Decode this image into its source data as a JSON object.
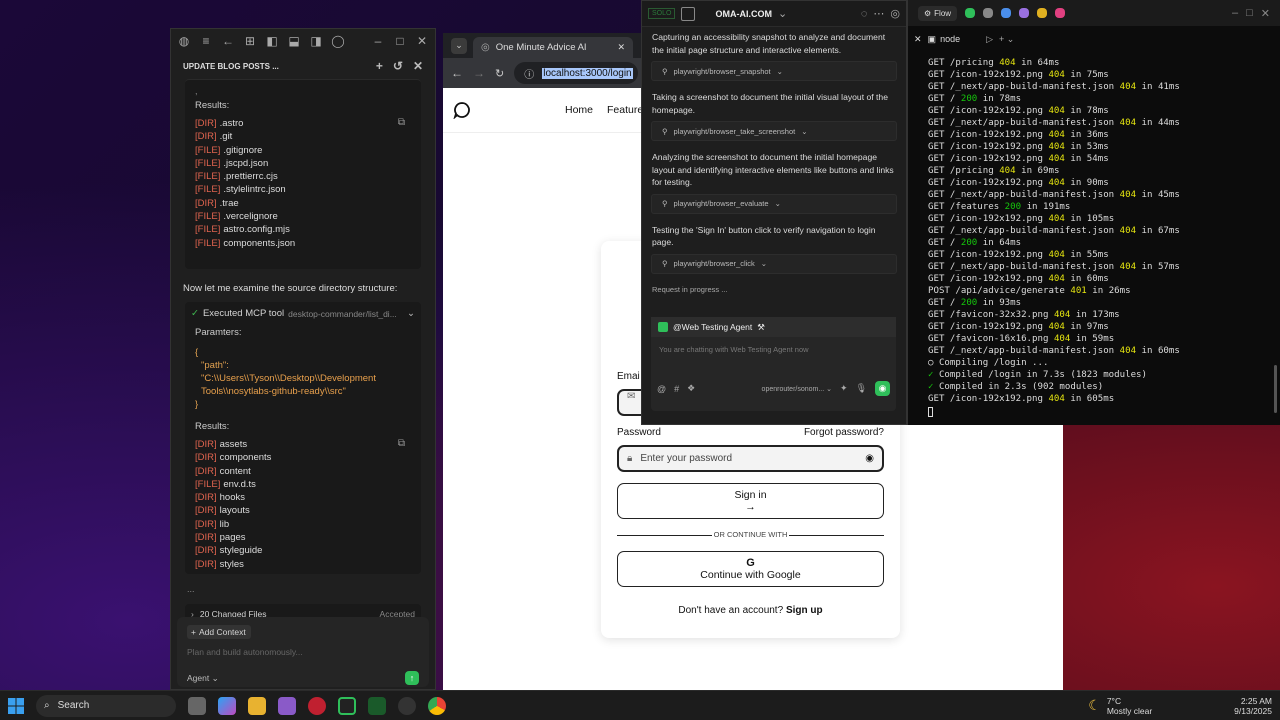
{
  "ide": {
    "header_title": "UPDATE BLOG POSTS ...",
    "results_label": "Results:",
    "results1": [
      {
        "tag": "[DIR]",
        "name": ".astro"
      },
      {
        "tag": "[DIR]",
        "name": ".git"
      },
      {
        "tag": "[FILE]",
        "name": ".gitignore"
      },
      {
        "tag": "[FILE]",
        "name": ".jscpd.json"
      },
      {
        "tag": "[FILE]",
        "name": ".prettierrc.cjs"
      },
      {
        "tag": "[FILE]",
        "name": ".stylelintrc.json"
      },
      {
        "tag": "[DIR]",
        "name": ".trae"
      },
      {
        "tag": "[FILE]",
        "name": ".vercelignore"
      },
      {
        "tag": "[FILE]",
        "name": "astro.config.mjs"
      },
      {
        "tag": "[FILE]",
        "name": "components.json"
      }
    ],
    "message": "Now let me examine the source directory structure:",
    "tool_label": "Executed MCP tool",
    "tool_name": "desktop-commander/list_di...",
    "params_label": "Paramters:",
    "code_open": "{",
    "code_key": "\"path\":",
    "code_val1": "\"C:\\\\Users\\\\Tyson\\\\Desktop\\\\Development",
    "code_val2": "Tools\\\\nosytlabs-github-ready\\\\src\"",
    "code_close": "}",
    "results2": [
      {
        "tag": "[DIR]",
        "name": "assets"
      },
      {
        "tag": "[DIR]",
        "name": "components"
      },
      {
        "tag": "[DIR]",
        "name": "content"
      },
      {
        "tag": "[FILE]",
        "name": "env.d.ts"
      },
      {
        "tag": "[DIR]",
        "name": "hooks"
      },
      {
        "tag": "[DIR]",
        "name": "layouts"
      },
      {
        "tag": "[DIR]",
        "name": "lib"
      },
      {
        "tag": "[DIR]",
        "name": "pages"
      },
      {
        "tag": "[DIR]",
        "name": "styleguide"
      },
      {
        "tag": "[DIR]",
        "name": "styles"
      }
    ],
    "dots": "...",
    "changed_files": "20 Changed Files",
    "accepted": "Accepted",
    "add_context": "Add Context",
    "input_placeholder": "Plan and build autonomously...",
    "mode": "Agent"
  },
  "browser": {
    "tab_title": "One Minute Advice AI",
    "url": "localhost:3000/login",
    "nav_home": "Home",
    "nav_features": "Features"
  },
  "login": {
    "email_label": "Emai",
    "password_label": "Password",
    "forgot": "Forgot password?",
    "password_placeholder": "Enter your password",
    "signin_label": "Sign in",
    "signin_arrow": "→",
    "divider": "OR CONTINUE WITH",
    "google_label": "Continue with Google",
    "no_account": "Don't have an account?",
    "signup": "Sign up"
  },
  "agent": {
    "badge": "SOLO",
    "title": "OMA-AI.COM",
    "flow": "Flow",
    "steps": [
      {
        "text": "Capturing an accessibility snapshot to analyze and document the initial page structure and interactive elements.",
        "tool": "playwright/browser_snapshot"
      },
      {
        "text": "Taking a screenshot to document the initial visual layout of the homepage.",
        "tool": "playwright/browser_take_screenshot"
      },
      {
        "text": "Analyzing the screenshot to document the initial homepage layout and identifying interactive elements like buttons and links for testing.",
        "tool": "playwright/browser_evaluate"
      },
      {
        "text": "Testing the 'Sign In' button click to verify navigation to login page.",
        "tool": "playwright/browser_click"
      }
    ],
    "progress": "Request in progress ...",
    "chat_agent": "@Web Testing Agent",
    "chat_placeholder": "You are chatting with Web Testing Agent now",
    "model": "openrouter/sonom..."
  },
  "terminal": {
    "tab": "node",
    "lines": [
      {
        "pre": "GET /pricing ",
        "code": "404",
        "post": " in 64ms",
        "c": "y"
      },
      {
        "pre": "GET /icon-192x192.png ",
        "code": "404",
        "post": " in 75ms",
        "c": "y"
      },
      {
        "pre": "GET /_next/app-build-manifest.json ",
        "code": "404",
        "post": " in 41ms",
        "c": "y"
      },
      {
        "pre": "GET / ",
        "code": "200",
        "post": " in 78ms",
        "c": "g"
      },
      {
        "pre": "GET /icon-192x192.png ",
        "code": "404",
        "post": " in 78ms",
        "c": "y"
      },
      {
        "pre": "GET /_next/app-build-manifest.json ",
        "code": "404",
        "post": " in 44ms",
        "c": "y"
      },
      {
        "pre": "GET /icon-192x192.png ",
        "code": "404",
        "post": " in 36ms",
        "c": "y"
      },
      {
        "pre": "GET /icon-192x192.png ",
        "code": "404",
        "post": " in 53ms",
        "c": "y"
      },
      {
        "pre": "GET /icon-192x192.png ",
        "code": "404",
        "post": " in 54ms",
        "c": "y"
      },
      {
        "pre": "GET /pricing ",
        "code": "404",
        "post": " in 69ms",
        "c": "y"
      },
      {
        "pre": "GET /icon-192x192.png ",
        "code": "404",
        "post": " in 90ms",
        "c": "y"
      },
      {
        "pre": "GET /_next/app-build-manifest.json ",
        "code": "404",
        "post": " in 45ms",
        "c": "y"
      },
      {
        "pre": "GET /features ",
        "code": "200",
        "post": " in 191ms",
        "c": "g"
      },
      {
        "pre": "GET /icon-192x192.png ",
        "code": "404",
        "post": " in 105ms",
        "c": "y"
      },
      {
        "pre": "GET /_next/app-build-manifest.json ",
        "code": "404",
        "post": " in 67ms",
        "c": "y"
      },
      {
        "pre": "GET / ",
        "code": "200",
        "post": " in 64ms",
        "c": "g"
      },
      {
        "pre": "GET /icon-192x192.png ",
        "code": "404",
        "post": " in 55ms",
        "c": "y"
      },
      {
        "pre": "GET /_next/app-build-manifest.json ",
        "code": "404",
        "post": " in 57ms",
        "c": "y"
      },
      {
        "pre": "GET /icon-192x192.png ",
        "code": "404",
        "post": " in 60ms",
        "c": "y"
      },
      {
        "pre": "POST /api/advice/generate ",
        "code": "401",
        "post": " in 26ms",
        "c": "y"
      },
      {
        "pre": "GET / ",
        "code": "200",
        "post": " in 93ms",
        "c": "g"
      },
      {
        "pre": "GET /favicon-32x32.png ",
        "code": "404",
        "post": " in 173ms",
        "c": "y"
      },
      {
        "pre": "GET /icon-192x192.png ",
        "code": "404",
        "post": " in 97ms",
        "c": "y"
      },
      {
        "pre": "GET /favicon-16x16.png ",
        "code": "404",
        "post": " in 59ms",
        "c": "y"
      },
      {
        "pre": "GET /_next/app-build-manifest.json ",
        "code": "404",
        "post": " in 60ms",
        "c": "y"
      },
      {
        "pre": "",
        "code": "○",
        "post": " Compiling /login ...",
        "c": "w"
      },
      {
        "pre": "",
        "code": "✓",
        "post": " Compiled /login in 7.3s (1823 modules)",
        "c": "g"
      },
      {
        "pre": "",
        "code": "✓",
        "post": " Compiled in 2.3s (902 modules)",
        "c": "g"
      },
      {
        "pre": "GET /icon-192x192.png ",
        "code": "404",
        "post": " in 605ms",
        "c": "y"
      }
    ]
  },
  "taskbar": {
    "search": "Search",
    "temp": "7°C",
    "weather": "Mostly clear",
    "time": "2:25 AM",
    "date": "9/13/2025"
  }
}
